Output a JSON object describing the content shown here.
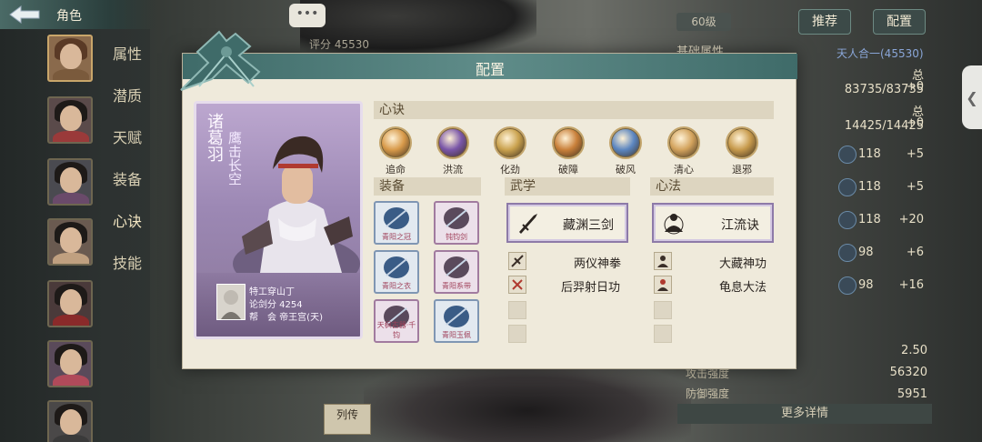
{
  "nav": {
    "title": "角色",
    "items": [
      "属性",
      "潜质",
      "天赋",
      "装备",
      "心诀",
      "技能"
    ]
  },
  "right_panel": {
    "level": "60级",
    "btn_recommend": "推荐",
    "btn_config": "配置",
    "basic_attr": "基础属性",
    "unity": "天人合一(45530)",
    "hp": "总83735/83735",
    "hp_plus": "+0",
    "mp": "总14425/14425",
    "mp_plus": "+0",
    "stats": [
      {
        "value": "118",
        "bonus": "+5"
      },
      {
        "value": "118",
        "bonus": "+5"
      },
      {
        "value": "118",
        "bonus": "+20"
      },
      {
        "value": "98",
        "bonus": "+6"
      },
      {
        "value": "98",
        "bonus": "+16"
      }
    ],
    "v1": "2.50",
    "attack_label": "攻击强度",
    "attack_value": "56320",
    "defense_label": "防御强度",
    "defense_value": "5951",
    "more": "更多详情"
  },
  "score_ribbon": "评分 45530",
  "chat": "•••",
  "bio_tag": "列传",
  "modal": {
    "title": "配置",
    "card": {
      "name": "诸葛羽",
      "title": "鹰击长空",
      "master_line1": "特工穿山丁",
      "master_line2": "论剑分 4254",
      "master_line3": "帮　会 帝王宫(天)"
    },
    "xinjue_header": "心诀",
    "xinjue": [
      {
        "label": "追命",
        "color": "#d89a4a"
      },
      {
        "label": "洪流",
        "color": "#7a56a8"
      },
      {
        "label": "化劲",
        "color": "#caa24e"
      },
      {
        "label": "破障",
        "color": "#c9803a"
      },
      {
        "label": "破风",
        "color": "#5c86c0"
      },
      {
        "label": "清心",
        "color": "#d3a35d"
      },
      {
        "label": "退邪",
        "color": "#c79a4c"
      }
    ],
    "equip_header": "装备",
    "equipment": [
      {
        "name": "青阳之冠",
        "type": "blue"
      },
      {
        "name": "钝钧剑",
        "type": "purple"
      },
      {
        "name": "青阳之衣",
        "type": "blue"
      },
      {
        "name": "青阳系带",
        "type": "purple"
      },
      {
        "name": "天枫古器·千钧",
        "type": "purple"
      },
      {
        "name": "青阳玉佩",
        "type": "blue"
      }
    ],
    "wuxue_header": "武学",
    "wuxue_main": "藏渊三剑",
    "wuxue_sub": [
      "两仪神拳",
      "后羿射日功"
    ],
    "xinfa_header": "心法",
    "xinfa_main": "江流诀",
    "xinfa_sub": [
      "大藏神功",
      "龟息大法"
    ]
  }
}
